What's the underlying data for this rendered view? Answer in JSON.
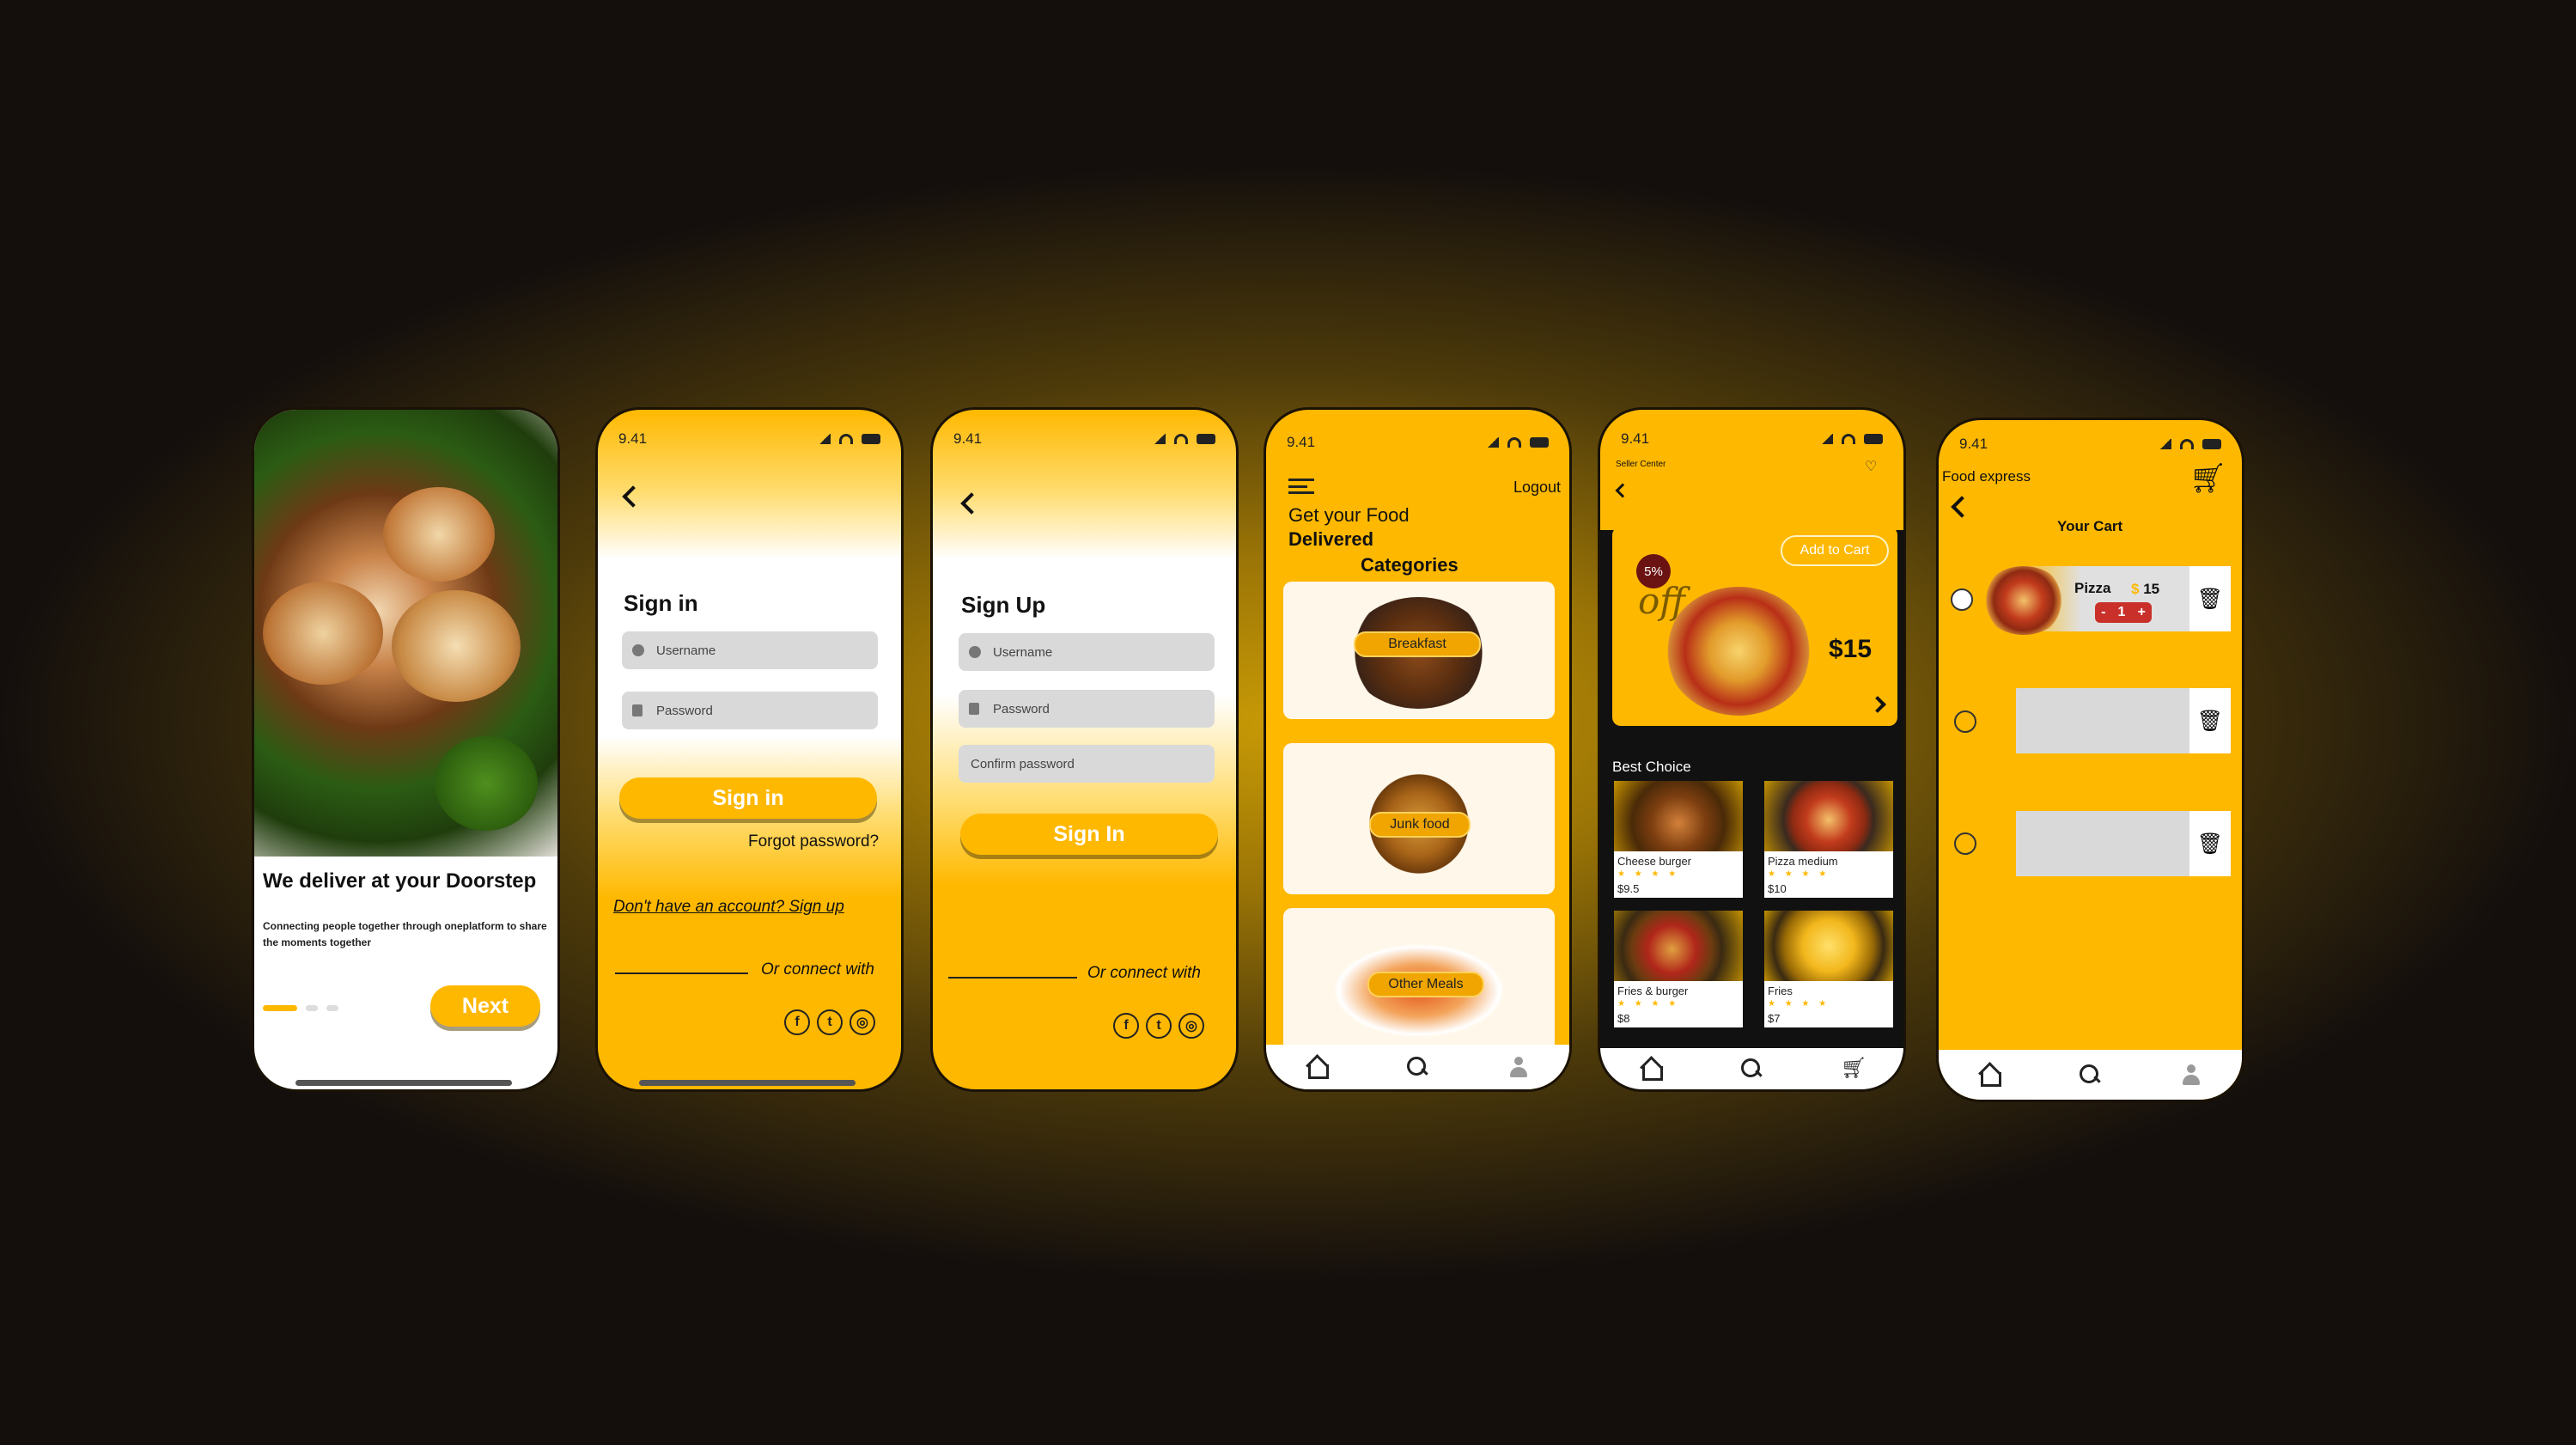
{
  "colors": {
    "accent": "#ffb800",
    "dark": "#111111",
    "card_bg": "#fff7ea"
  },
  "status_bar": {
    "time": "9.41"
  },
  "onboarding": {
    "headline": "We deliver at your Doorstep",
    "subtitle": "Connecting people together through oneplatform to share the moments together",
    "next_label": "Next"
  },
  "sign_in": {
    "title": "Sign in",
    "username_placeholder": "Username",
    "password_placeholder": "Password",
    "button_label": "Sign in",
    "forgot_password": "Forgot password?",
    "signup_prompt": "Don't have an account? Sign up",
    "connect_with": "Or connect with"
  },
  "sign_up": {
    "title": "Sign Up",
    "username_placeholder": "Username",
    "password_placeholder": "Password",
    "confirm_placeholder": "Confirm password",
    "button_label": "Sign In",
    "connect_with": "Or connect with"
  },
  "home": {
    "logout": "Logout",
    "headline_1": "Get your Food",
    "headline_2": "Delivered",
    "categories_title": "Categories",
    "categories": [
      {
        "label": "Breakfast"
      },
      {
        "label": "Junk food"
      },
      {
        "label": "Other Meals"
      }
    ]
  },
  "product": {
    "seller_center": "Seller Center",
    "discount": "5%",
    "off": "off",
    "add_to_cart": "Add to Cart",
    "price": "$15",
    "best_choice": "Best Choice",
    "items": [
      {
        "name": "Cheese burger",
        "stars": "★ ★ ★ ★",
        "price": "$9.5"
      },
      {
        "name": "Pizza medium",
        "stars": "★ ★ ★ ★",
        "price": "$10"
      },
      {
        "name": "Fries & burger",
        "stars": "★ ★ ★ ★",
        "price": "$8"
      },
      {
        "name": "Fries",
        "stars": "★ ★ ★ ★",
        "price": "$7"
      }
    ]
  },
  "cart": {
    "app_name": "Food express",
    "title": "Your Cart",
    "item_name": "Pizza",
    "currency": "$",
    "item_price": "15",
    "minus": "-",
    "quantity": "1",
    "plus": "+"
  },
  "icons": [
    "back-arrow-icon",
    "signal-icon",
    "wifi-icon",
    "battery-icon",
    "user-icon",
    "lock-icon",
    "facebook-icon",
    "twitter-icon",
    "instagram-icon",
    "menu-icon",
    "heart-icon",
    "chevron-right-icon",
    "home-icon",
    "search-icon",
    "cart-icon",
    "trash-icon"
  ]
}
